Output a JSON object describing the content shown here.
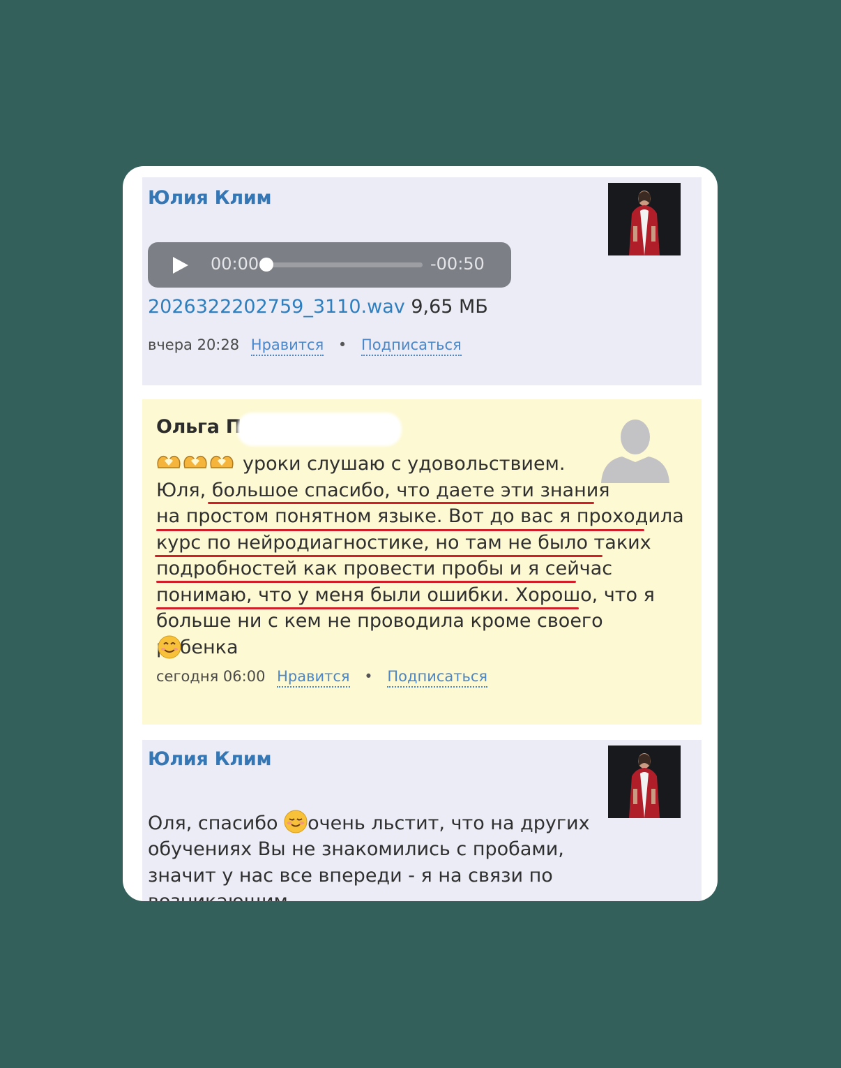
{
  "comments": [
    {
      "author": "Юлия Клим",
      "audio": {
        "current_time": "00:00",
        "remaining_time": "-00:50",
        "progress": 0.05
      },
      "file": {
        "name": "2026322202759_3110.wav",
        "size": "9,65 МБ"
      },
      "time": "вчера 20:28",
      "like_label": "Нравится",
      "subscribe_label": "Подписаться"
    },
    {
      "author": "Ольга П",
      "text": "уроки слушаю с удовольствием.\nЮля, большое спасибо, что даете эти знания\nна простом понятном языке. Вот до вас я проходила\nкурс по нейродиагностике, но там не было таких\nподробностей как провести пробы и я сейчас\nпонимаю, что у меня были ошибки. Хорошо, что я\nбольше ни с кем не проводила кроме своего ребенка",
      "time": "сегодня 06:00",
      "like_label": "Нравится",
      "subscribe_label": "Подписаться"
    },
    {
      "author": "Юлия Клим",
      "text_before_emoji": "Оля, спасибо ",
      "text": "очень льстит, что на других\nобучениях Вы не знакомились с пробами,\nзначит у нас все впереди - я на связи по возникающим\nвопросам!"
    }
  ],
  "icons": {
    "play": "play-icon",
    "avatar_placeholder": "default-avatar-icon",
    "heart_hands": "heart-hands-emoji",
    "smile": "smiling-face-emoji",
    "blush": "relieved-smile-emoji"
  },
  "colors": {
    "background": "#33605b",
    "author": "#3576b5",
    "link": "#4a86c8",
    "highlight_bg": "#fdf9d2",
    "underline": "#d11f2a"
  }
}
